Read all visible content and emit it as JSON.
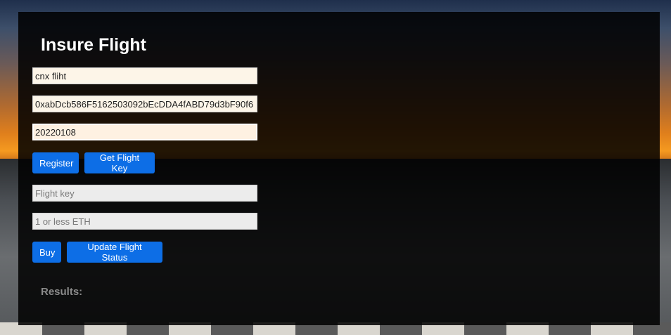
{
  "page": {
    "title": "Insure Flight"
  },
  "register_form": {
    "flight_name": "cnx fliht",
    "airline_address": "0xabDcb586F5162503092bEcDDA4fABD79d3bF90f6",
    "timestamp": "20220108",
    "register_label": "Register",
    "get_key_label": "Get Flight Key"
  },
  "buy_form": {
    "flight_key_placeholder": "Flight key",
    "amount_placeholder": "1 or less ETH",
    "buy_label": "Buy",
    "update_status_label": "Update Flight Status"
  },
  "results": {
    "label": "Results:"
  }
}
